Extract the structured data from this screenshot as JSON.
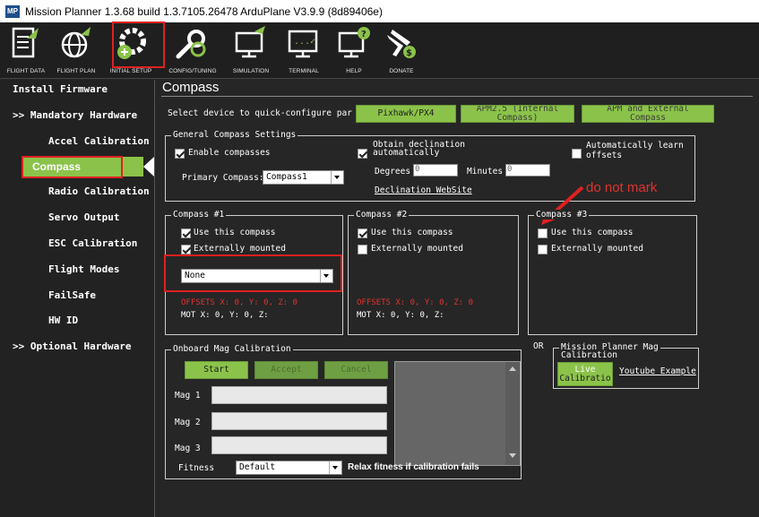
{
  "window": {
    "title": "Mission Planner 1.3.68 build 1.3.7105.26478 ArduPlane V3.9.9 (8d89406e)",
    "app_icon": "MP"
  },
  "toolbar": {
    "items": [
      {
        "label": "FLIGHT DATA",
        "icon": "flight-data-icon"
      },
      {
        "label": "FLIGHT PLAN",
        "icon": "flight-plan-icon"
      },
      {
        "label": "INITIAL SETUP",
        "icon": "initial-setup-icon"
      },
      {
        "label": "CONFIG/TUNING",
        "icon": "config-tuning-icon"
      },
      {
        "label": "SIMULATION",
        "icon": "simulation-icon"
      },
      {
        "label": "TERMINAL",
        "icon": "terminal-icon"
      },
      {
        "label": "HELP",
        "icon": "help-icon"
      },
      {
        "label": "DONATE",
        "icon": "donate-icon"
      }
    ]
  },
  "sidebar": {
    "install_firmware": "Install Firmware",
    "mandatory_hardware": ">> Mandatory Hardware",
    "items": [
      "Accel Calibration",
      "Compass",
      "Radio Calibration",
      "Servo Output",
      "ESC Calibration",
      "Flight Modes",
      "FailSafe",
      "HW ID"
    ],
    "optional_hardware": ">> Optional Hardware",
    "selected": "Compass"
  },
  "page": {
    "title": "Compass",
    "quick_configure_label": "Select device to quick-configure par",
    "quick_buttons": [
      {
        "label": "Pixhawk/PX4"
      },
      {
        "line1": "APM2.5 (Internal",
        "line2": "Compass)"
      },
      {
        "line1": "APM and External",
        "line2": "Compass"
      }
    ]
  },
  "general": {
    "title": "General Compass Settings",
    "enable_compasses": "Enable compasses",
    "primary_compass_label": "Primary Compass:",
    "primary_compass_value": "Compass1",
    "obtain_declination_line1": "Obtain declination",
    "obtain_declination_line2": "automatically",
    "degrees_label": "Degrees",
    "degrees_value": "0",
    "minutes_label": "Minutes",
    "minutes_value": "0",
    "declination_link": "Declination WebSite",
    "auto_learn_line1": "Automatically learn",
    "auto_learn_line2": "offsets"
  },
  "compass1": {
    "title": "Compass #1",
    "use": "Use this compass",
    "external": "Externally mounted",
    "orientation": "None",
    "offsets": "OFFSETS  X: 0,    Y: 0,    Z: 0",
    "mot": "MOT         X: 0,    Y: 0,    Z:"
  },
  "compass2": {
    "title": "Compass #2",
    "use": "Use this compass",
    "external": "Externally mounted",
    "offsets": "OFFSETS  X: 0,    Y: 0,    Z: 0",
    "mot": "MOT         X: 0,    Y: 0,    Z:"
  },
  "compass3": {
    "title": "Compass #3",
    "use": "Use this compass",
    "external": "Externally mounted"
  },
  "annotation": {
    "text": "do not mark",
    "color": "#e0342e"
  },
  "onboard": {
    "title": "Onboard Mag Calibration",
    "start": "Start",
    "accept": "Accept",
    "cancel": "Cancel",
    "mag1": "Mag 1",
    "mag2": "Mag 2",
    "mag3": "Mag 3",
    "fitness_label": "Fitness",
    "fitness_value": "Default",
    "relax_label": "Relax fitness if calibration fails"
  },
  "or_label": "OR",
  "mp_mag": {
    "title_line1": "Mission Planner Mag",
    "title_line2": "Calibration",
    "live_line1": "Live",
    "live_line2": "Calibratio",
    "youtube": "Youtube Example"
  },
  "colors": {
    "accent_green": "#8bc34a",
    "highlight_red": "#e02020",
    "background": "#262626"
  }
}
